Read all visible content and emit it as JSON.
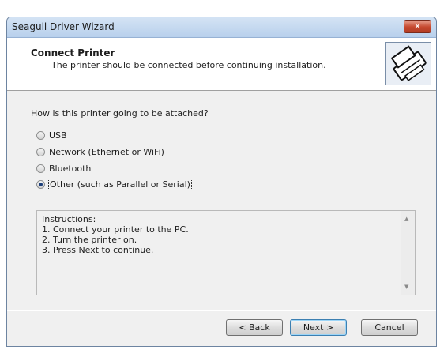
{
  "window": {
    "title": "Seagull Driver Wizard",
    "close_label": "✕"
  },
  "header": {
    "title": "Connect Printer",
    "subtitle": "The printer should be connected before continuing installation.",
    "icon": "printer-icon"
  },
  "question": "How is this printer going to be attached?",
  "options": [
    {
      "label": "USB",
      "checked": false
    },
    {
      "label": "Network (Ethernet or WiFi)",
      "checked": false
    },
    {
      "label": "Bluetooth",
      "checked": false
    },
    {
      "label": "Other (such as Parallel or Serial)",
      "checked": true
    }
  ],
  "instructions": [
    "Instructions:",
    "1. Connect your printer to the PC.",
    "2. Turn the printer on.",
    "3. Press Next to continue."
  ],
  "buttons": {
    "back": "< Back",
    "next": "Next >",
    "cancel": "Cancel"
  }
}
